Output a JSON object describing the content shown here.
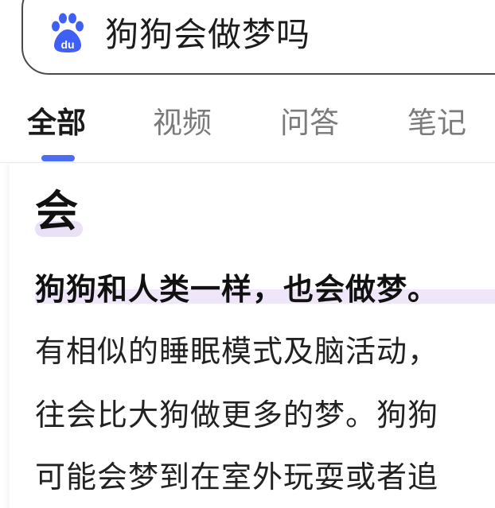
{
  "search": {
    "query": "狗狗会做梦吗",
    "logo": "baidu-paw-icon"
  },
  "tabs": [
    {
      "label": "全部",
      "active": true
    },
    {
      "label": "视频",
      "active": false
    },
    {
      "label": "问答",
      "active": false
    },
    {
      "label": "笔记",
      "active": false
    }
  ],
  "answer": {
    "verdict": "会",
    "lines": [
      "狗狗和人类一样，也会做梦。",
      "有相似的睡眠模式及脑活动，",
      "往会比大狗做更多的梦。狗狗",
      "可能会梦到在室外玩耍或者追"
    ]
  },
  "colors": {
    "accent": "#4e6ef2",
    "highlight": "#efe6fa",
    "border": "#4a4a4a"
  }
}
